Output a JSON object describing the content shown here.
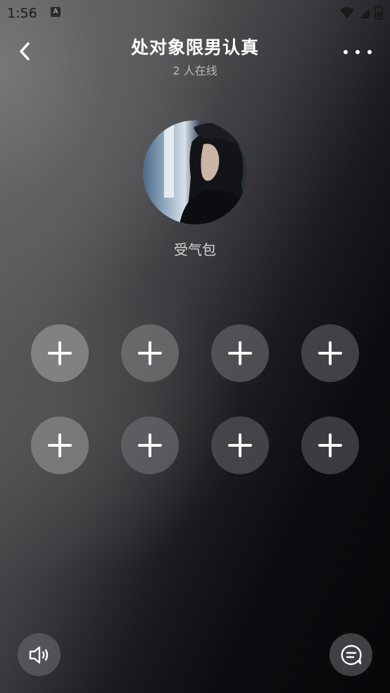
{
  "status_bar": {
    "time": "1:56",
    "notification_icon": "A",
    "icons": [
      "wifi-icon",
      "signal-icon",
      "battery-icon"
    ]
  },
  "header": {
    "back_icon": "chevron-left-icon",
    "title": "处对象限男认真",
    "subtitle": "2 人在线",
    "more_icon": "more-dots-icon"
  },
  "host": {
    "avatar": "host-avatar",
    "name": "受气包"
  },
  "seats": [
    {
      "row": 1,
      "icon": "plus-icon",
      "label": "empty-seat"
    },
    {
      "row": 1,
      "icon": "plus-icon",
      "label": "empty-seat"
    },
    {
      "row": 1,
      "icon": "plus-icon",
      "label": "empty-seat"
    },
    {
      "row": 1,
      "icon": "plus-icon",
      "label": "empty-seat"
    },
    {
      "row": 2,
      "icon": "plus-icon",
      "label": "empty-seat"
    },
    {
      "row": 2,
      "icon": "plus-icon",
      "label": "empty-seat"
    },
    {
      "row": 2,
      "icon": "plus-icon",
      "label": "empty-seat"
    },
    {
      "row": 2,
      "icon": "plus-icon",
      "label": "empty-seat"
    }
  ],
  "bottom_bar": {
    "speaker_icon": "speaker-icon",
    "chat_icon": "chat-bubble-icon"
  },
  "colors": {
    "text_primary": "#ffffff",
    "text_secondary": "#b9b9bb",
    "seat_light": "#8a8a8c",
    "seat_dark": "#3c3c40"
  }
}
